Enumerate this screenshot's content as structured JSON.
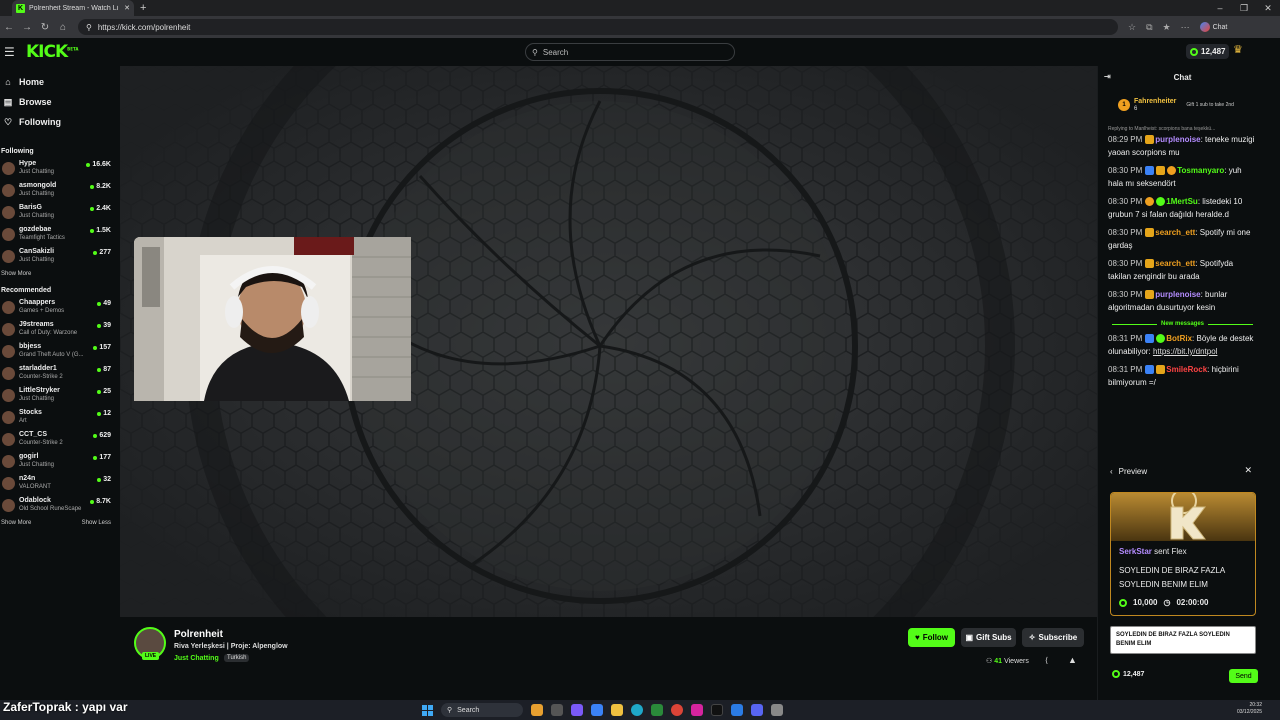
{
  "browser": {
    "tab_title": "Polrenheit Stream - Watch Li",
    "url": "https://kick.com/polrenheit",
    "chat_chip": "Chat"
  },
  "header": {
    "logo": "KICK",
    "logo_badge": "BETA",
    "search_placeholder": "Search",
    "points": "12,487"
  },
  "sidebar": {
    "nav": [
      {
        "label": "Home",
        "icon": "home-icon"
      },
      {
        "label": "Browse",
        "icon": "browse-icon"
      },
      {
        "label": "Following",
        "icon": "heart-icon"
      }
    ],
    "following_title": "Following",
    "following": [
      {
        "name": "Hype",
        "cat": "Just Chatting",
        "viewers": "16.6K"
      },
      {
        "name": "asmongold",
        "cat": "Just Chatting",
        "viewers": "8.2K"
      },
      {
        "name": "BarisG",
        "cat": "Just Chatting",
        "viewers": "2.4K"
      },
      {
        "name": "gozdebae",
        "cat": "Teamfight Tactics",
        "viewers": "1.5K"
      },
      {
        "name": "CanSakizli",
        "cat": "Just Chatting",
        "viewers": "277"
      }
    ],
    "show_more": "Show More",
    "recommended_title": "Recommended",
    "recommended": [
      {
        "name": "Chaappers",
        "cat": "Games + Demos",
        "viewers": "49"
      },
      {
        "name": "J9streams",
        "cat": "Call of Duty: Warzone",
        "viewers": "39"
      },
      {
        "name": "bbjess",
        "cat": "Grand Theft Auto V (G...",
        "viewers": "157"
      },
      {
        "name": "starladder1",
        "cat": "Counter-Strike 2",
        "viewers": "87"
      },
      {
        "name": "LittleStryker",
        "cat": "Just Chatting",
        "viewers": "25"
      },
      {
        "name": "Stocks",
        "cat": "Art",
        "viewers": "12"
      },
      {
        "name": "CCT_CS",
        "cat": "Counter-Strike 2",
        "viewers": "629"
      },
      {
        "name": "gogirl",
        "cat": "Just Chatting",
        "viewers": "177"
      },
      {
        "name": "n24n",
        "cat": "VALORANT",
        "viewers": "32"
      },
      {
        "name": "Odablock",
        "cat": "Old School RuneScape",
        "viewers": "8.7K"
      }
    ],
    "show_more2": "Show More",
    "show_less": "Show Less"
  },
  "stream": {
    "name": "Polrenheit",
    "title": "Riva Yerleşkesi | Proje: Alpenglow",
    "category": "Just Chatting",
    "tag": "Turkish",
    "live": "LIVE",
    "follow": "Follow",
    "gift": "Gift Subs",
    "subscribe": "Subscribe",
    "viewers": "41",
    "viewers_label": "Viewers"
  },
  "chat": {
    "title": "Chat",
    "pinned_rank": "1",
    "pinned_name": "Fahrenheiter",
    "pinned_count": "6",
    "pinned_gift": "Gift 1 sub to take 2nd",
    "reply_text": "Replying to Manlheist: scorpions bana teşekkü...",
    "messages": [
      {
        "time": "08:29 PM",
        "user": "purplenoise",
        "color": "#b48cff",
        "text": "teneke muzigi yaoan scorpions mu"
      },
      {
        "time": "08:30 PM",
        "user": "Tosmanyaro",
        "color": "#53fc18",
        "text": "yuh hala mı seksendört"
      },
      {
        "time": "08:30 PM",
        "user": "1MertSu",
        "color": "#53fc18",
        "text": "listedeki 10 grubun 7 si falan dağıldı heralde.d"
      },
      {
        "time": "08:30 PM",
        "user": "search_ett",
        "color": "#f0a020",
        "text": "Spotify mi one gardaş"
      },
      {
        "time": "08:30 PM",
        "user": "search_ett",
        "color": "#f0a020",
        "text": "Spotifyda takilan zengindir bu arada"
      },
      {
        "time": "08:30 PM",
        "user": "purplenoise",
        "color": "#b48cff",
        "text": "bunlar algoritmadan dusurtuyor kesin"
      }
    ],
    "new_messages": "New messages",
    "messages_after": [
      {
        "time": "08:31 PM",
        "user": "BotRix",
        "color": "#f0a020",
        "text": "Böyle de destek olunabiliyor:",
        "link": "https://bit.ly/dntpol"
      },
      {
        "time": "08:31 PM",
        "user": "SmileRock",
        "color": "#ff4444",
        "text": "hiçbirini bilmiyorum =/"
      }
    ],
    "preview_title": "Preview",
    "card_sender": "SerkStar",
    "card_action": "sent Flex",
    "card_message": "SOYLEDIN DE BIRAZ FAZLA SOYLEDIN BENIM ELIM",
    "card_amount": "10,000",
    "card_duration": "02:00:00",
    "input_value": "SOYLEDIN DE BIRAZ FAZLA SOYLEDIN BENIM ELIM",
    "points": "12,487",
    "send": "Send"
  },
  "overlay": {
    "caption": "ZaferToprak : yapı var"
  },
  "taskbar": {
    "search": "Search",
    "time": "20:32",
    "date": "03/12/2025"
  },
  "colors": {
    "accent": "#53fc18",
    "bg": "#0b0e0f"
  }
}
